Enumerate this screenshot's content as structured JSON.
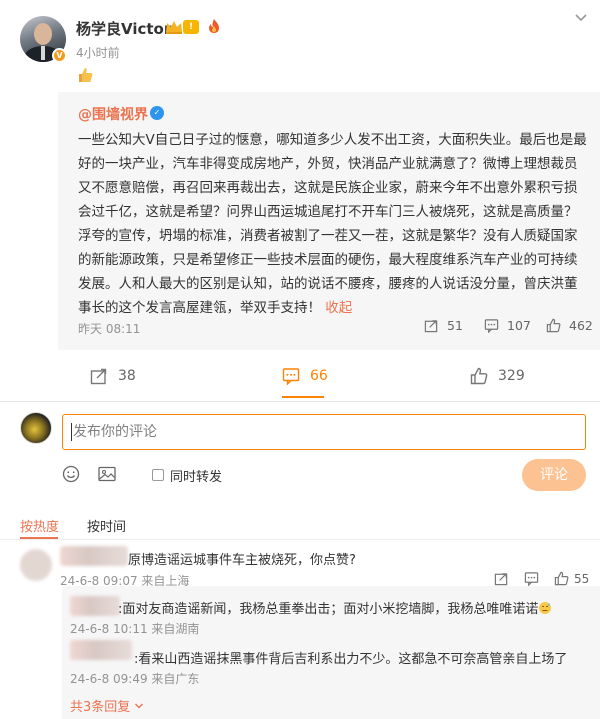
{
  "post": {
    "author": "杨学良Victor",
    "level_badge": "!",
    "time": "4小时前"
  },
  "repost": {
    "author": "@围墙视界",
    "text": "一些公知大V自己日子过的惬意，哪知道多少人发不出工资，大面积失业。最后也是最好的一块产业，汽车非得变成房地产，外贸，快消品产业就满意了？微博上理想裁员又不愿意赔偿，再召回来再裁出去，这就是民族企业家，蔚来今年不出意外累积亏损会过千亿，这就是希望？问界山西运城追尾打不开车门三人被烧死，这就是高质量？浮夸的宣传，坍塌的标准，消费者被割了一茬又一茬，这就是繁华？没有人质疑国家的新能源政策，只是希望修正一些技术层面的硬伤，最大程度维系汽车产业的可持续发展。人和人最大的区别是认知，站的说话不腰疼，腰疼的人说话没分量，曾庆洪董事长的这个发言高屋建瓴，举双手支持！",
    "collapse_label": "收起",
    "date": "昨天 08:11",
    "reposts": "51",
    "comments": "107",
    "likes": "462"
  },
  "actions": {
    "repost_count": "38",
    "comment_count": "66",
    "like_count": "329"
  },
  "composer": {
    "placeholder": "发布你的评论",
    "also_repost_label": "同时转发",
    "submit_label": "评论"
  },
  "sort": {
    "hot_label": "按热度",
    "time_label": "按时间"
  },
  "comments": [
    {
      "text": "原博造谣运城事件车主被烧死，你点赞?",
      "meta": "24-6-8 09:07 来自上海",
      "likes": "55"
    }
  ],
  "replies": [
    {
      "text": ":面对友商造谣新闻，我杨总重拳出击；面对小米挖墙脚，我杨总唯唯诺诺",
      "meta": "24-6-8 10:11 来自湖南"
    },
    {
      "text": ":看来山西造谣抹黑事件背后吉利系出力不少。这都急不可奈高管亲自上场了",
      "meta": "24-6-8 09:49 来自广东"
    }
  ],
  "expand_label": "共3条回复",
  "colors": {
    "accent": "#ff8200",
    "link": "#eb7350",
    "meta": "#939393"
  },
  "icons": [
    "chevron-down-icon",
    "crown-icon",
    "fire-icon",
    "thumbs-up-icon",
    "verified-icon",
    "repost-icon",
    "comment-icon",
    "like-icon",
    "smile-icon",
    "image-icon",
    "checkbox-icon"
  ]
}
